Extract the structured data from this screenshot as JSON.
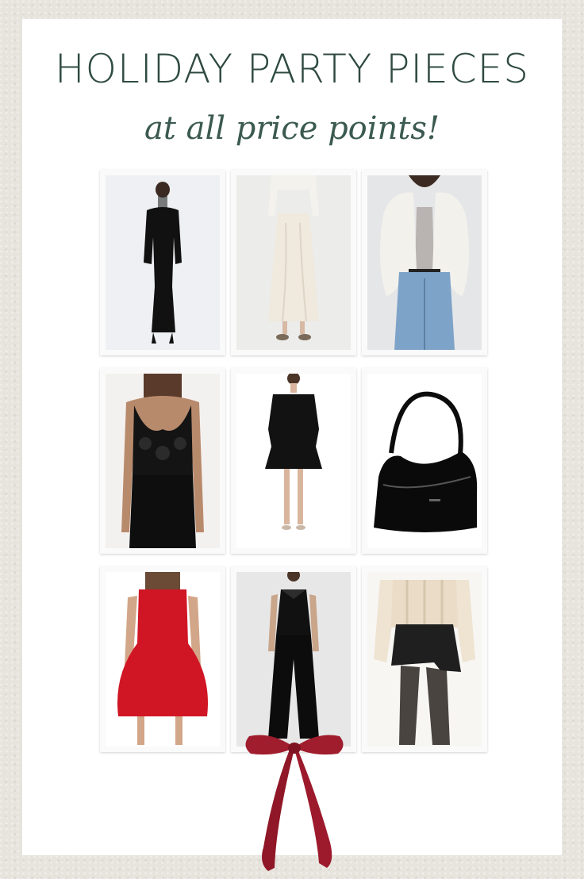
{
  "header": {
    "title": "HOLIDAY PARTY PIECES",
    "subtitle": "at all price points!"
  },
  "products": [
    {
      "id": "velvet-maxi-dress",
      "icon": "black-sheer-neck-maxi-dress"
    },
    {
      "id": "satin-maxi-skirt",
      "icon": "ivory-satin-skirt"
    },
    {
      "id": "faux-fur-jacket",
      "icon": "white-faux-fur-jacket"
    },
    {
      "id": "lace-bodysuit",
      "icon": "black-lace-bodysuit"
    },
    {
      "id": "off-shoulder-mini-dress",
      "icon": "black-off-shoulder-dress"
    },
    {
      "id": "patent-shoulder-bag",
      "icon": "black-patent-handbag"
    },
    {
      "id": "red-mini-dress",
      "icon": "red-bubble-mini-dress"
    },
    {
      "id": "velvet-jumpsuit",
      "icon": "black-strapless-jumpsuit"
    },
    {
      "id": "cable-sweater-skort",
      "icon": "cream-sweater-black-skort"
    }
  ],
  "colors": {
    "title": "#2f4a42",
    "bow": "#9d1b2b",
    "background": "#e7e4dd"
  }
}
